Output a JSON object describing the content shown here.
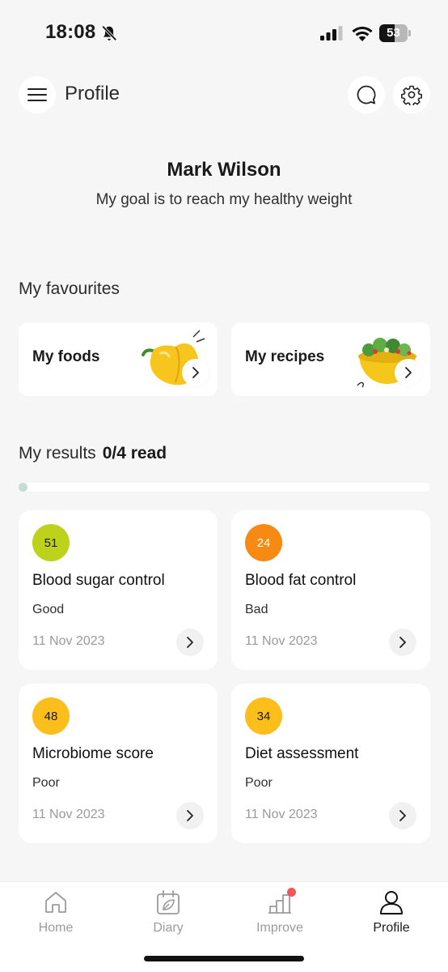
{
  "status_bar": {
    "time": "18:08",
    "battery": "53",
    "battery_level": 0.53
  },
  "header": {
    "title": "Profile",
    "icons": [
      "hamburger-menu-icon",
      "chat-bubble-icon",
      "gear-icon"
    ]
  },
  "profile": {
    "name": "Mark Wilson",
    "goal": "My goal is to reach my healthy weight"
  },
  "favourites": {
    "title": "My favourites",
    "items": [
      {
        "label": "My foods",
        "image": "yellow-pepper"
      },
      {
        "label": "My recipes",
        "image": "salad-bowl"
      }
    ]
  },
  "results": {
    "title": "My results",
    "read_count": "0/4 read",
    "progress": 0.0,
    "cards": [
      {
        "score": "51",
        "title": "Blood sugar control",
        "status": "Good",
        "date": "11 Nov 2023",
        "color": "#bcd21b"
      },
      {
        "score": "24",
        "title": "Blood fat control",
        "status": "Bad",
        "date": "11 Nov 2023",
        "color": "#f78a12"
      },
      {
        "score": "48",
        "title": "Microbiome score",
        "status": "Poor",
        "date": "11 Nov 2023",
        "color": "#fbbe1a"
      },
      {
        "score": "34",
        "title": "Diet assessment",
        "status": "Poor",
        "date": "11 Nov 2023",
        "color": "#fbbe1a"
      }
    ]
  },
  "bottom_nav": {
    "items": [
      {
        "label": "Home",
        "icon": "home-icon"
      },
      {
        "label": "Diary",
        "icon": "diary-icon"
      },
      {
        "label": "Improve",
        "icon": "improve-icon"
      },
      {
        "label": "Profile",
        "icon": "profile-icon"
      }
    ],
    "active": "Profile",
    "notification_color": "#f0565a"
  }
}
